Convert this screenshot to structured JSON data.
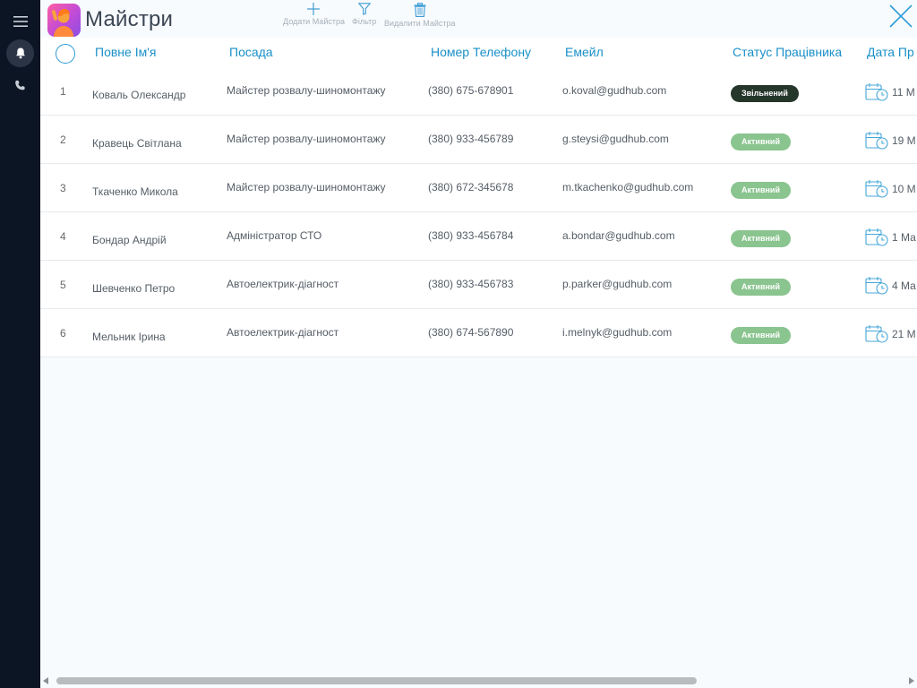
{
  "app": {
    "title": "Майстри"
  },
  "toolbar": {
    "add_label": "Додати Майстра",
    "filter_label": "Фільтр",
    "delete_label": "Видалити Майстра"
  },
  "columns": {
    "name": "Повне Ім'я",
    "position": "Посада",
    "phone": "Номер Телефону",
    "email": "Емейл",
    "status": "Статус Працівника",
    "date": "Дата Пр"
  },
  "rows": [
    {
      "num": "1",
      "name": "Коваль Олександр",
      "position": "Майстер розвалу-шиномонтажу",
      "phone": "(380) 675-678901",
      "email": "o.koval@gudhub.com",
      "status": "Звільнений",
      "status_type": "fired",
      "date": "11 М"
    },
    {
      "num": "2",
      "name": "Кравець Світлана",
      "position": "Майстер розвалу-шиномонтажу",
      "phone": "(380) 933-456789",
      "email": "g.steysi@gudhub.com",
      "status": "Активний",
      "status_type": "active",
      "date": "19 М"
    },
    {
      "num": "3",
      "name": "Ткаченко Микола",
      "position": "Майстер розвалу-шиномонтажу",
      "phone": "(380) 672-345678",
      "email": "m.tkachenko@gudhub.com",
      "status": "Активний",
      "status_type": "active",
      "date": "10 М"
    },
    {
      "num": "4",
      "name": "Бондар Андрій",
      "position": "Адміністратор СТО",
      "phone": "(380) 933-456784",
      "email": "a.bondar@gudhub.com",
      "status": "Активний",
      "status_type": "active",
      "date": "1 Ма"
    },
    {
      "num": "5",
      "name": "Шевченко Петро",
      "position": "Автоелектрик-діагност",
      "phone": "(380) 933-456783",
      "email": "p.parker@gudhub.com",
      "status": "Активний",
      "status_type": "active",
      "date": "4 Ма"
    },
    {
      "num": "6",
      "name": "Мельник Ірина",
      "position": "Автоелектрик-діагност",
      "phone": "(380) 674-567890",
      "email": "i.melnyk@gudhub.com",
      "status": "Активний",
      "status_type": "active",
      "date": "21 М"
    }
  ],
  "colors": {
    "sidebar_bg": "#0c1524",
    "accent": "#1a90c8",
    "badge_fired": "#25362a",
    "badge_active": "#8ac48f"
  },
  "icons": {
    "menu": "menu-icon",
    "bell": "bell-icon",
    "phone": "phone-icon",
    "add": "plus-icon",
    "filter": "filter-icon",
    "delete": "trash-icon",
    "close": "close-icon",
    "calendar": "calendar-clock-icon"
  }
}
